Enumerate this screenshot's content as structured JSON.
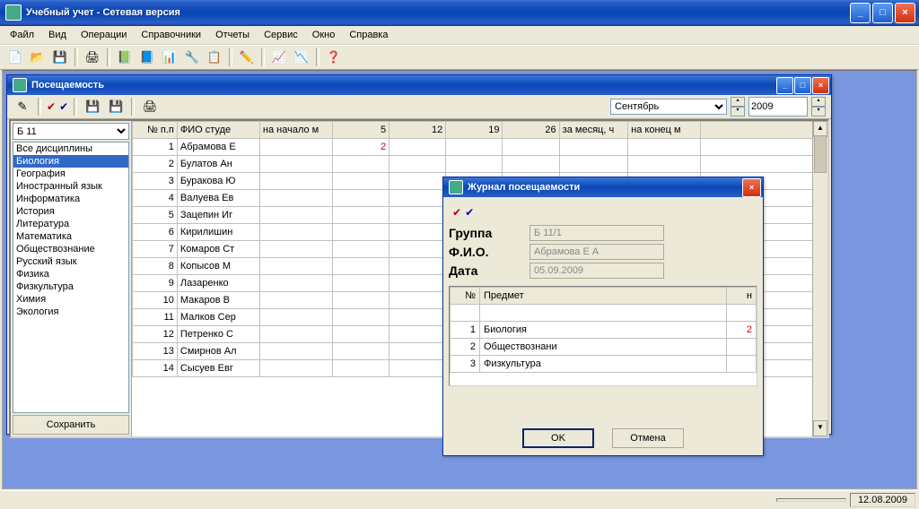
{
  "app": {
    "title": "Учебный учет  -  Сетевая версия"
  },
  "menu": [
    "Файл",
    "Вид",
    "Операции",
    "Справочники",
    "Отчеты",
    "Сервис",
    "Окно",
    "Справка"
  ],
  "toolbar_icons": [
    "📄",
    "📂",
    "💾",
    "",
    "🖨",
    "",
    "📗",
    "📘",
    "📊",
    "🔧",
    "📋",
    "",
    "✏️",
    "",
    "📈",
    "📉",
    "",
    "❓"
  ],
  "status": {
    "date": "12.08.2009"
  },
  "attendance": {
    "title": "Посещаемость",
    "month": "Сентябрь",
    "year": "2009",
    "group": "Б 11",
    "subjects": [
      "Все дисциплины",
      "Биология",
      "География",
      "Иностранный язык",
      "Информатика",
      "История",
      "Литература",
      "Математика",
      "Обществознание",
      "Русский язык",
      "Физика",
      "Физкультура",
      "Химия",
      "Экология"
    ],
    "selected_subject_index": 1,
    "save_label": "Сохранить",
    "columns": [
      "№ п.п",
      "ФИО студе",
      "на начало м",
      "5",
      "12",
      "19",
      "26",
      "за месяц, ч",
      "на конец м"
    ],
    "rows": [
      {
        "n": 1,
        "fio": "Абрамова Е",
        "c": [
          "",
          "2",
          "",
          "",
          "",
          "",
          ""
        ]
      },
      {
        "n": 2,
        "fio": "Булатов Ан",
        "c": [
          "",
          "",
          "",
          "",
          "",
          "",
          ""
        ]
      },
      {
        "n": 3,
        "fio": "Буракова Ю",
        "c": [
          "",
          "",
          "",
          "",
          "",
          "",
          ""
        ]
      },
      {
        "n": 4,
        "fio": "Валуева Ев",
        "c": [
          "",
          "",
          "",
          "",
          "",
          "",
          ""
        ]
      },
      {
        "n": 5,
        "fio": "Зацепин Иг",
        "c": [
          "",
          "",
          "",
          "",
          "",
          "",
          ""
        ]
      },
      {
        "n": 6,
        "fio": "Кирилишин",
        "c": [
          "",
          "",
          "",
          "",
          "",
          "",
          ""
        ]
      },
      {
        "n": 7,
        "fio": "Комаров Ст",
        "c": [
          "",
          "",
          "",
          "",
          "",
          "",
          ""
        ]
      },
      {
        "n": 8,
        "fio": "Копысов М",
        "c": [
          "",
          "",
          "",
          "",
          "",
          "",
          ""
        ]
      },
      {
        "n": 9,
        "fio": "Лазаренко",
        "c": [
          "",
          "",
          "",
          "",
          "",
          "",
          ""
        ]
      },
      {
        "n": 10,
        "fio": "Макаров В",
        "c": [
          "",
          "",
          "",
          "",
          "",
          "",
          ""
        ]
      },
      {
        "n": 11,
        "fio": "Малков Сер",
        "c": [
          "",
          "",
          "",
          "",
          "",
          "",
          ""
        ]
      },
      {
        "n": 12,
        "fio": "Петренко С",
        "c": [
          "",
          "",
          "",
          "",
          "",
          "",
          ""
        ]
      },
      {
        "n": 13,
        "fio": "Смирнов Ал",
        "c": [
          "",
          "",
          "",
          "",
          "",
          "",
          ""
        ]
      },
      {
        "n": 14,
        "fio": "Сысуев Евг",
        "c": [
          "",
          "",
          "",
          "",
          "",
          "",
          ""
        ]
      }
    ]
  },
  "journal": {
    "title": "Журнал посещаемости",
    "labels": {
      "group": "Группа",
      "fio": "Ф.И.О.",
      "date": "Дата"
    },
    "group": "Б 11/1",
    "fio": "Абрамова Е А",
    "date": "05.09.2009",
    "columns": [
      "№",
      "Предмет",
      "н"
    ],
    "rows": [
      {
        "n": 1,
        "subj": "Биология",
        "h": "2"
      },
      {
        "n": 2,
        "subj": "Обществознани",
        "h": ""
      },
      {
        "n": 3,
        "subj": "Физкультура",
        "h": ""
      }
    ],
    "ok": "OK",
    "cancel": "Отмена"
  }
}
